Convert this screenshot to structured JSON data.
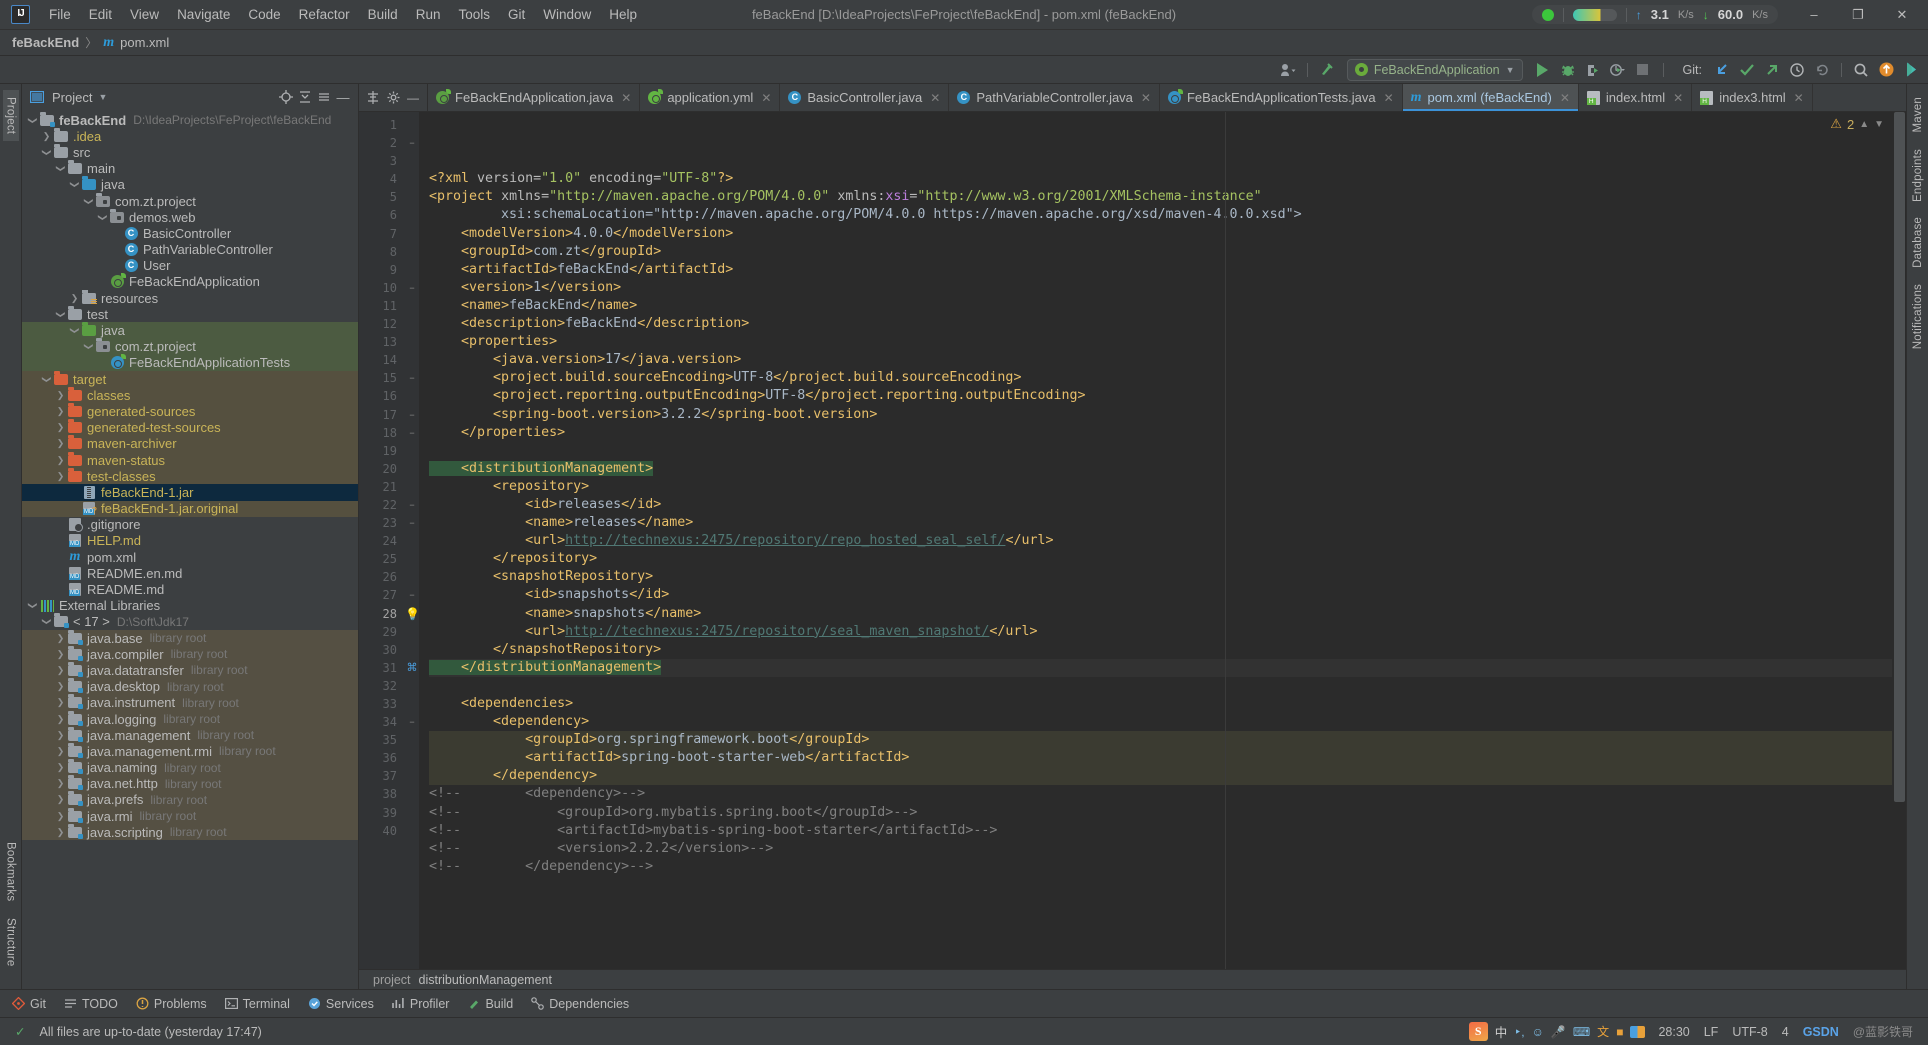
{
  "window": {
    "title": "feBackEnd [D:\\IdeaProjects\\FeProject\\feBackEnd] - pom.xml (feBackEnd)",
    "logo": "IJ",
    "minimize": "–",
    "maximize": "❐",
    "close": "✕"
  },
  "menu": [
    "File",
    "Edit",
    "View",
    "Navigate",
    "Code",
    "Refactor",
    "Build",
    "Run",
    "Tools",
    "Git",
    "Window",
    "Help"
  ],
  "network": {
    "upload_value": "3.1",
    "upload_unit": "K/s",
    "download_value": "60.0",
    "download_unit": "K/s"
  },
  "breadcrumb": {
    "project": "feBackEnd",
    "separator": "〉",
    "file": "pom.xml"
  },
  "toolbar": {
    "run_config": "FeBackEndApplication",
    "git_label": "Git:",
    "run_tooltip": "Run",
    "debug_tooltip": "Debug",
    "coverage_tooltip": "Run with Coverage",
    "profile_tooltip": "Profile",
    "stop_tooltip": "Stop",
    "update_tooltip": "Update Project",
    "commit_tooltip": "Commit",
    "push_tooltip": "Push",
    "history_tooltip": "History",
    "rollback_tooltip": "Rollback",
    "search_tooltip": "Search Everywhere",
    "settings_tooltip": "Settings"
  },
  "project_panel": {
    "title": "Project",
    "tree": [
      {
        "depth": 0,
        "arrow": "v",
        "icon": "folder-module",
        "label": "feBackEnd",
        "sub": "D:\\IdeaProjects\\FeProject\\feBackEnd",
        "color": "#bbbbbb",
        "bold": true
      },
      {
        "depth": 1,
        "arrow": ">",
        "icon": "folder",
        "label": ".idea",
        "color": "#c9b458"
      },
      {
        "depth": 1,
        "arrow": "v",
        "icon": "folder",
        "label": "src",
        "color": "#bbbbbb"
      },
      {
        "depth": 2,
        "arrow": "v",
        "icon": "folder",
        "label": "main",
        "color": "#bbbbbb"
      },
      {
        "depth": 3,
        "arrow": "v",
        "icon": "folder-blue",
        "label": "java",
        "color": "#bbbbbb"
      },
      {
        "depth": 4,
        "arrow": "v",
        "icon": "package",
        "label": "com.zt.project",
        "color": "#bbbbbb"
      },
      {
        "depth": 5,
        "arrow": "v",
        "icon": "package",
        "label": "demos.web",
        "color": "#bbbbbb"
      },
      {
        "depth": 6,
        "arrow": "",
        "icon": "class",
        "label": "BasicController",
        "color": "#bbbbbb"
      },
      {
        "depth": 6,
        "arrow": "",
        "icon": "class",
        "label": "PathVariableController",
        "color": "#bbbbbb"
      },
      {
        "depth": 6,
        "arrow": "",
        "icon": "class",
        "label": "User",
        "color": "#bbbbbb"
      },
      {
        "depth": 5,
        "arrow": "",
        "icon": "spring-app",
        "label": "FeBackEndApplication",
        "color": "#bbbbbb"
      },
      {
        "depth": 3,
        "arrow": ">",
        "icon": "folder-resource",
        "label": "resources",
        "color": "#bbbbbb"
      },
      {
        "depth": 2,
        "arrow": "v",
        "icon": "folder",
        "label": "test",
        "color": "#bbbbbb"
      },
      {
        "depth": 3,
        "arrow": "v",
        "icon": "folder-green",
        "label": "java",
        "color": "#bbbbbb",
        "hl": "green"
      },
      {
        "depth": 4,
        "arrow": "v",
        "icon": "package",
        "label": "com.zt.project",
        "color": "#bbbbbb",
        "hl": "green"
      },
      {
        "depth": 5,
        "arrow": "",
        "icon": "spring-test",
        "label": "FeBackEndApplicationTests",
        "color": "#bbbbbb",
        "hl": "green"
      },
      {
        "depth": 1,
        "arrow": "v",
        "icon": "folder-orange",
        "label": "target",
        "color": "#c9b458",
        "hl": "brown"
      },
      {
        "depth": 2,
        "arrow": ">",
        "icon": "folder-orange",
        "label": "classes",
        "color": "#c9b458",
        "hl": "brown"
      },
      {
        "depth": 2,
        "arrow": ">",
        "icon": "folder-orange",
        "label": "generated-sources",
        "color": "#c9b458",
        "hl": "brown"
      },
      {
        "depth": 2,
        "arrow": ">",
        "icon": "folder-orange",
        "label": "generated-test-sources",
        "color": "#c9b458",
        "hl": "brown"
      },
      {
        "depth": 2,
        "arrow": ">",
        "icon": "folder-orange",
        "label": "maven-archiver",
        "color": "#c9b458",
        "hl": "brown"
      },
      {
        "depth": 2,
        "arrow": ">",
        "icon": "folder-orange",
        "label": "maven-status",
        "color": "#c9b458",
        "hl": "brown"
      },
      {
        "depth": 2,
        "arrow": ">",
        "icon": "folder-orange",
        "label": "test-classes",
        "color": "#c9b458",
        "hl": "brown"
      },
      {
        "depth": 3,
        "arrow": "",
        "icon": "jar",
        "label": "feBackEnd-1.jar",
        "color": "#c9b458",
        "hl": "blue-select"
      },
      {
        "depth": 3,
        "arrow": "",
        "icon": "file-unknown",
        "label": "feBackEnd-1.jar.original",
        "color": "#c9b458",
        "hl": "brown"
      },
      {
        "depth": 2,
        "arrow": "",
        "icon": "gitignore",
        "label": ".gitignore",
        "color": "#bbbbbb"
      },
      {
        "depth": 2,
        "arrow": "",
        "icon": "markdown",
        "label": "HELP.md",
        "color": "#c9b458"
      },
      {
        "depth": 2,
        "arrow": "",
        "icon": "maven",
        "label": "pom.xml",
        "color": "#bbbbbb"
      },
      {
        "depth": 2,
        "arrow": "",
        "icon": "markdown",
        "label": "README.en.md",
        "color": "#bbbbbb"
      },
      {
        "depth": 2,
        "arrow": "",
        "icon": "markdown",
        "label": "README.md",
        "color": "#bbbbbb"
      },
      {
        "depth": 0,
        "arrow": "v",
        "icon": "libraries",
        "label": "External Libraries",
        "color": "#bbbbbb"
      },
      {
        "depth": 1,
        "arrow": "v",
        "icon": "folder-jdk",
        "label": "< 17 >",
        "sub": "D:\\Soft\\Jdk17",
        "color": "#bbbbbb"
      },
      {
        "depth": 2,
        "arrow": ">",
        "icon": "folder-lib",
        "label": "java.base",
        "sub": "library root",
        "color": "#bbbbbb",
        "hl": "olive"
      },
      {
        "depth": 2,
        "arrow": ">",
        "icon": "folder-lib",
        "label": "java.compiler",
        "sub": "library root",
        "color": "#bbbbbb",
        "hl": "olive"
      },
      {
        "depth": 2,
        "arrow": ">",
        "icon": "folder-lib",
        "label": "java.datatransfer",
        "sub": "library root",
        "color": "#bbbbbb",
        "hl": "olive"
      },
      {
        "depth": 2,
        "arrow": ">",
        "icon": "folder-lib",
        "label": "java.desktop",
        "sub": "library root",
        "color": "#bbbbbb",
        "hl": "olive"
      },
      {
        "depth": 2,
        "arrow": ">",
        "icon": "folder-lib",
        "label": "java.instrument",
        "sub": "library root",
        "color": "#bbbbbb",
        "hl": "olive"
      },
      {
        "depth": 2,
        "arrow": ">",
        "icon": "folder-lib",
        "label": "java.logging",
        "sub": "library root",
        "color": "#bbbbbb",
        "hl": "olive"
      },
      {
        "depth": 2,
        "arrow": ">",
        "icon": "folder-lib",
        "label": "java.management",
        "sub": "library root",
        "color": "#bbbbbb",
        "hl": "olive"
      },
      {
        "depth": 2,
        "arrow": ">",
        "icon": "folder-lib",
        "label": "java.management.rmi",
        "sub": "library root",
        "color": "#bbbbbb",
        "hl": "olive"
      },
      {
        "depth": 2,
        "arrow": ">",
        "icon": "folder-lib",
        "label": "java.naming",
        "sub": "library root",
        "color": "#bbbbbb",
        "hl": "olive"
      },
      {
        "depth": 2,
        "arrow": ">",
        "icon": "folder-lib",
        "label": "java.net.http",
        "sub": "library root",
        "color": "#bbbbbb",
        "hl": "olive"
      },
      {
        "depth": 2,
        "arrow": ">",
        "icon": "folder-lib",
        "label": "java.prefs",
        "sub": "library root",
        "color": "#bbbbbb",
        "hl": "olive"
      },
      {
        "depth": 2,
        "arrow": ">",
        "icon": "folder-lib",
        "label": "java.rmi",
        "sub": "library root",
        "color": "#bbbbbb",
        "hl": "olive"
      },
      {
        "depth": 2,
        "arrow": ">",
        "icon": "folder-lib",
        "label": "java.scripting",
        "sub": "library root",
        "color": "#bbbbbb",
        "hl": "olive"
      }
    ]
  },
  "left_strips": {
    "project": "Project",
    "structure": "Structure",
    "bookmarks": "Bookmarks"
  },
  "right_strips": [
    "Maven",
    "Endpoints",
    "Database",
    "Notifications"
  ],
  "tabs": [
    {
      "label": "FeBackEndApplication.java",
      "icon": "spring-app-icon",
      "active": false
    },
    {
      "label": "application.yml",
      "icon": "yaml-icon",
      "active": false
    },
    {
      "label": "BasicController.java",
      "icon": "java-class-icon",
      "active": false
    },
    {
      "label": "PathVariableController.java",
      "icon": "java-class-icon",
      "active": false
    },
    {
      "label": "FeBackEndApplicationTests.java",
      "icon": "spring-test-icon",
      "active": false
    },
    {
      "label": "pom.xml (feBackEnd)",
      "icon": "maven-icon",
      "active": true
    },
    {
      "label": "index.html",
      "icon": "html-icon",
      "active": false
    },
    {
      "label": "index3.html",
      "icon": "html-icon",
      "active": false
    }
  ],
  "editor": {
    "warning_count": "2",
    "first_line": 1,
    "last_line": 40,
    "lines": [
      {
        "n": 1,
        "text": "<?xml version=\"1.0\" encoding=\"UTF-8\"?>"
      },
      {
        "n": 2,
        "text": "<project xmlns=\"http://maven.apache.org/POM/4.0.0\" xmlns:xsi=\"http://www.w3.org/2001/XMLSchema-instance\"",
        "fold": true
      },
      {
        "n": 3,
        "text": "         xsi:schemaLocation=\"http://maven.apache.org/POM/4.0.0 https://maven.apache.org/xsd/maven-4.0.0.xsd\">"
      },
      {
        "n": 4,
        "text": "    <modelVersion>4.0.0</modelVersion>"
      },
      {
        "n": 5,
        "text": "    <groupId>com.zt</groupId>"
      },
      {
        "n": 6,
        "text": "    <artifactId>feBackEnd</artifactId>"
      },
      {
        "n": 7,
        "text": "    <version>1</version>"
      },
      {
        "n": 8,
        "text": "    <name>feBackEnd</name>"
      },
      {
        "n": 9,
        "text": "    <description>feBackEnd</description>"
      },
      {
        "n": 10,
        "text": "    <properties>",
        "fold": true
      },
      {
        "n": 11,
        "text": "        <java.version>17</java.version>"
      },
      {
        "n": 12,
        "text": "        <project.build.sourceEncoding>UTF-8</project.build.sourceEncoding>"
      },
      {
        "n": 13,
        "text": "        <project.reporting.outputEncoding>UTF-8</project.reporting.outputEncoding>"
      },
      {
        "n": 14,
        "text": "        <spring-boot.version>3.2.2</spring-boot.version>"
      },
      {
        "n": 15,
        "text": "    </properties>",
        "fold": true
      },
      {
        "n": 16,
        "text": ""
      },
      {
        "n": 17,
        "text": "    <distributionManagement>",
        "fold": true,
        "selected": true
      },
      {
        "n": 18,
        "text": "        <repository>",
        "fold": true
      },
      {
        "n": 19,
        "text": "            <id>releases</id>"
      },
      {
        "n": 20,
        "text": "            <name>releases</name>"
      },
      {
        "n": 21,
        "text": "            <url>http://technexus:2475/repository/repo_hosted_seal_self/</url>"
      },
      {
        "n": 22,
        "text": "        </repository>",
        "fold": true
      },
      {
        "n": 23,
        "text": "        <snapshotRepository>",
        "fold": true
      },
      {
        "n": 24,
        "text": "            <id>snapshots</id>"
      },
      {
        "n": 25,
        "text": "            <name>snapshots</name>"
      },
      {
        "n": 26,
        "text": "            <url>http://technexus:2475/repository/seal_maven_snapshot/</url>"
      },
      {
        "n": 27,
        "text": "        </snapshotRepository>",
        "fold": true
      },
      {
        "n": 28,
        "text": "    </distributionManagement>",
        "fold": true,
        "selected": true,
        "bulb": true,
        "caret": true
      },
      {
        "n": 29,
        "text": ""
      },
      {
        "n": 30,
        "text": "    <dependencies>"
      },
      {
        "n": 31,
        "text": "        <dependency>",
        "gutterIcon": "spring-bean"
      },
      {
        "n": 32,
        "text": "            <groupId>org.springframework.boot</groupId>",
        "highlight": true
      },
      {
        "n": 33,
        "text": "            <artifactId>spring-boot-starter-web</artifactId>",
        "highlight": true
      },
      {
        "n": 34,
        "text": "        </dependency>",
        "highlight": true,
        "fold": true
      },
      {
        "n": 35,
        "text": "<!--        <dependency>-->"
      },
      {
        "n": 36,
        "text": "<!--            <groupId>org.mybatis.spring.boot</groupId>-->"
      },
      {
        "n": 37,
        "text": "<!--            <artifactId>mybatis-spring-boot-starter</artifactId>-->"
      },
      {
        "n": 38,
        "text": "<!--            <version>2.2.2</version>-->"
      },
      {
        "n": 39,
        "text": "<!--        </dependency>-->"
      },
      {
        "n": 40,
        "text": ""
      }
    ],
    "breadcrumb": [
      "project",
      "distributionManagement"
    ]
  },
  "tool_windows": [
    {
      "label": "Git",
      "icon": "git-icon"
    },
    {
      "label": "TODO",
      "icon": "todo-icon"
    },
    {
      "label": "Problems",
      "icon": "problems-icon"
    },
    {
      "label": "Terminal",
      "icon": "terminal-icon"
    },
    {
      "label": "Services",
      "icon": "services-icon"
    },
    {
      "label": "Profiler",
      "icon": "profiler-icon"
    },
    {
      "label": "Build",
      "icon": "build-icon"
    },
    {
      "label": "Dependencies",
      "icon": "dependencies-icon"
    }
  ],
  "status": {
    "message": "All files are up-to-date (yesterday 17:47)",
    "position": "28:30",
    "line_separator": "LF",
    "encoding": "UTF-8",
    "indent": "4",
    "gsdn": "GSDN",
    "watermark": "@蓝影铁哥",
    "ime_char": "S",
    "ime_lang": "中"
  },
  "colors": {
    "accent_blue": "#3c92d8",
    "run_green": "#59a869",
    "warning_yellow": "#c9ae5e",
    "selection_blue": "#0d293e",
    "tag_yellow": "#e8bf6a",
    "string_green": "#a5c261",
    "comment_gray": "#808080"
  }
}
